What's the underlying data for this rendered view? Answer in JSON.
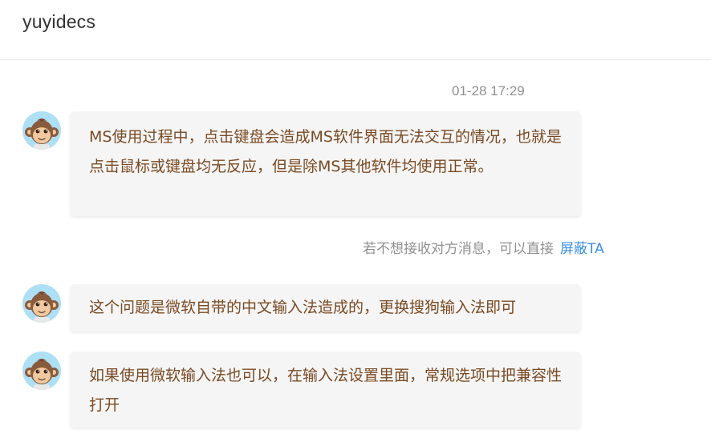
{
  "header": {
    "title": "yuyidecs"
  },
  "conversation": {
    "timestamp": "01-28 17:29",
    "messages": [
      {
        "text": "MS使用过程中，点击键盘会造成MS软件界面无法交互的情况，也就是点击鼠标或键盘均无反应，但是除MS其他软件均使用正常。"
      },
      {
        "text": "这个问题是微软自带的中文输入法造成的，更换搜狗输入法即可"
      },
      {
        "text": "如果使用微软输入法也可以，在输入法设置里面，常规选项中把兼容性打开"
      }
    ],
    "notice": {
      "text": "若不想接收对方消息，可以直接",
      "link_label": "屏蔽TA"
    }
  },
  "icons": {
    "avatar": "monkey-avatar-icon"
  },
  "colors": {
    "bubble_bg": "#f5f5f6",
    "message_text": "#7a4a22",
    "link": "#3a8ee6",
    "muted": "#909090"
  }
}
